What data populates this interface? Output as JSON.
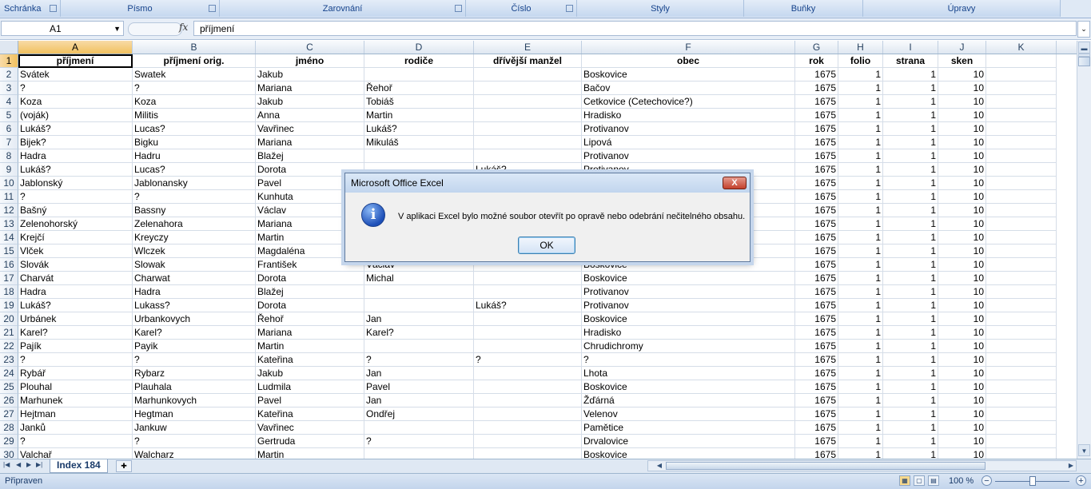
{
  "ribbon": {
    "groups": [
      "Schránka",
      "Písmo",
      "Zarovnání",
      "Číslo",
      "Styly",
      "Buňky",
      "Úpravy"
    ]
  },
  "formula_bar": {
    "name_box": "A1",
    "fx": "fx",
    "content": "příjmení"
  },
  "columns": [
    "A",
    "B",
    "C",
    "D",
    "E",
    "F",
    "G",
    "H",
    "I",
    "J",
    "K"
  ],
  "header_row": [
    "příjmení",
    "příjmení orig.",
    "jméno",
    "rodiče",
    "dřívější manžel",
    "obec",
    "rok",
    "folio",
    "strana",
    "sken",
    ""
  ],
  "rows": [
    {
      "n": "2",
      "a": "Svátek",
      "b": "Swatek",
      "c": "Jakub",
      "d": "",
      "e": "",
      "f": "Boskovice",
      "g": "1675",
      "h": "1",
      "i": "1",
      "j": "10"
    },
    {
      "n": "3",
      "a": "?",
      "b": "?",
      "c": "Mariana",
      "d": "Řehoř",
      "e": "",
      "f": "Bačov",
      "g": "1675",
      "h": "1",
      "i": "1",
      "j": "10"
    },
    {
      "n": "4",
      "a": "Koza",
      "b": "Koza",
      "c": "Jakub",
      "d": "Tobiáš",
      "e": "",
      "f": "Cetkovice (Cetechovice?)",
      "g": "1675",
      "h": "1",
      "i": "1",
      "j": "10"
    },
    {
      "n": "5",
      "a": "(voják)",
      "b": "Militis",
      "c": "Anna",
      "d": "Martin",
      "e": "",
      "f": "Hradisko",
      "g": "1675",
      "h": "1",
      "i": "1",
      "j": "10"
    },
    {
      "n": "6",
      "a": "Lukáš?",
      "b": "Lucas?",
      "c": "Vavřinec",
      "d": "Lukáš?",
      "e": "",
      "f": "Protivanov",
      "g": "1675",
      "h": "1",
      "i": "1",
      "j": "10"
    },
    {
      "n": "7",
      "a": "Bijek?",
      "b": "Bigku",
      "c": "Mariana",
      "d": "Mikuláš",
      "e": "",
      "f": "Lipová",
      "g": "1675",
      "h": "1",
      "i": "1",
      "j": "10"
    },
    {
      "n": "8",
      "a": "Hadra",
      "b": "Hadru",
      "c": "Blažej",
      "d": "",
      "e": "",
      "f": "Protivanov",
      "g": "1675",
      "h": "1",
      "i": "1",
      "j": "10"
    },
    {
      "n": "9",
      "a": "Lukáš?",
      "b": "Lucas?",
      "c": "Dorota",
      "d": "",
      "e": "Lukáš?",
      "f": "Protivanov",
      "g": "1675",
      "h": "1",
      "i": "1",
      "j": "10"
    },
    {
      "n": "10",
      "a": "Jablonský",
      "b": "Jablonansky",
      "c": "Pavel",
      "d": "",
      "e": "",
      "f": "",
      "g": "1675",
      "h": "1",
      "i": "1",
      "j": "10"
    },
    {
      "n": "11",
      "a": "?",
      "b": "?",
      "c": "Kunhuta",
      "d": "",
      "e": "",
      "f": "",
      "g": "1675",
      "h": "1",
      "i": "1",
      "j": "10"
    },
    {
      "n": "12",
      "a": "Bašný",
      "b": "Bassny",
      "c": "Václav",
      "d": "",
      "e": "",
      "f": "",
      "g": "1675",
      "h": "1",
      "i": "1",
      "j": "10"
    },
    {
      "n": "13",
      "a": "Zelenohorský",
      "b": "Zelenahora",
      "c": "Mariana",
      "d": "",
      "e": "",
      "f": "",
      "g": "1675",
      "h": "1",
      "i": "1",
      "j": "10"
    },
    {
      "n": "14",
      "a": "Krejčí",
      "b": "Kreyczy",
      "c": "Martin",
      "d": "",
      "e": "",
      "f": "",
      "g": "1675",
      "h": "1",
      "i": "1",
      "j": "10"
    },
    {
      "n": "15",
      "a": "Vlček",
      "b": "Wlczek",
      "c": "Magdaléna",
      "d": "",
      "e": "",
      "f": "",
      "g": "1675",
      "h": "1",
      "i": "1",
      "j": "10"
    },
    {
      "n": "16",
      "a": "Slovák",
      "b": "Slowak",
      "c": "František",
      "d": "Václav",
      "e": "",
      "f": "Boskovice",
      "g": "1675",
      "h": "1",
      "i": "1",
      "j": "10"
    },
    {
      "n": "17",
      "a": "Charvát",
      "b": "Charwat",
      "c": "Dorota",
      "d": "Michal",
      "e": "",
      "f": "Boskovice",
      "g": "1675",
      "h": "1",
      "i": "1",
      "j": "10"
    },
    {
      "n": "18",
      "a": "Hadra",
      "b": "Hadra",
      "c": "Blažej",
      "d": "",
      "e": "",
      "f": "Protivanov",
      "g": "1675",
      "h": "1",
      "i": "1",
      "j": "10"
    },
    {
      "n": "19",
      "a": "Lukáš?",
      "b": "Lukass?",
      "c": "Dorota",
      "d": "",
      "e": "Lukáš?",
      "f": "Protivanov",
      "g": "1675",
      "h": "1",
      "i": "1",
      "j": "10"
    },
    {
      "n": "20",
      "a": "Urbánek",
      "b": "Urbankovych",
      "c": "Řehoř",
      "d": "Jan",
      "e": "",
      "f": "Boskovice",
      "g": "1675",
      "h": "1",
      "i": "1",
      "j": "10"
    },
    {
      "n": "21",
      "a": "Karel?",
      "b": "Karel?",
      "c": "Mariana",
      "d": "Karel?",
      "e": "",
      "f": "Hradisko",
      "g": "1675",
      "h": "1",
      "i": "1",
      "j": "10"
    },
    {
      "n": "22",
      "a": "Pajík",
      "b": "Payik",
      "c": "Martin",
      "d": "",
      "e": "",
      "f": "Chrudichromy",
      "g": "1675",
      "h": "1",
      "i": "1",
      "j": "10"
    },
    {
      "n": "23",
      "a": "?",
      "b": "?",
      "c": "Kateřina",
      "d": "?",
      "e": "?",
      "f": "?",
      "g": "1675",
      "h": "1",
      "i": "1",
      "j": "10"
    },
    {
      "n": "24",
      "a": "Rybář",
      "b": "Rybarz",
      "c": "Jakub",
      "d": "Jan",
      "e": "",
      "f": "Lhota",
      "g": "1675",
      "h": "1",
      "i": "1",
      "j": "10"
    },
    {
      "n": "25",
      "a": "Plouhal",
      "b": "Plauhala",
      "c": "Ludmila",
      "d": "Pavel",
      "e": "",
      "f": "Boskovice",
      "g": "1675",
      "h": "1",
      "i": "1",
      "j": "10"
    },
    {
      "n": "26",
      "a": "Marhunek",
      "b": "Marhunkovych",
      "c": "Pavel",
      "d": "Jan",
      "e": "",
      "f": "Žďárná",
      "g": "1675",
      "h": "1",
      "i": "1",
      "j": "10"
    },
    {
      "n": "27",
      "a": "Hejtman",
      "b": "Hegtman",
      "c": "Kateřina",
      "d": "Ondřej",
      "e": "",
      "f": "Velenov",
      "g": "1675",
      "h": "1",
      "i": "1",
      "j": "10"
    },
    {
      "n": "28",
      "a": "Janků",
      "b": "Jankuw",
      "c": "Vavřinec",
      "d": "",
      "e": "",
      "f": "Pamětice",
      "g": "1675",
      "h": "1",
      "i": "1",
      "j": "10"
    },
    {
      "n": "29",
      "a": "?",
      "b": "?",
      "c": "Gertruda",
      "d": "?",
      "e": "",
      "f": "Drvalovice",
      "g": "1675",
      "h": "1",
      "i": "1",
      "j": "10"
    },
    {
      "n": "30",
      "a": "Valchař",
      "b": "Walcharz",
      "c": "Martin",
      "d": "",
      "e": "",
      "f": "Boskovice",
      "g": "1675",
      "h": "1",
      "i": "1",
      "j": "10"
    }
  ],
  "sheet_tabs": {
    "active": "Index 184"
  },
  "status": {
    "ready": "Připraven",
    "zoom": "100 %"
  },
  "dialog": {
    "title": "Microsoft Office Excel",
    "message": "V aplikaci Excel bylo možné soubor otevřít po opravě nebo odebrání nečitelného obsahu.",
    "ok": "OK",
    "close": "X",
    "icon": "info-icon"
  },
  "colors": {
    "accent": "#15428b",
    "selection": "#f1c15f"
  }
}
